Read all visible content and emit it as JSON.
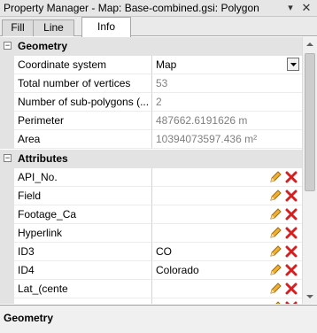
{
  "window": {
    "title": "Property Manager - Map: Base-combined.gsi: Polygon",
    "pin_icon": "pin-icon",
    "close_icon": "close-icon"
  },
  "tabs": [
    {
      "label": "Fill",
      "active": false
    },
    {
      "label": "Line",
      "active": false
    },
    {
      "label": "Info",
      "active": true
    }
  ],
  "geometry": {
    "category": "Geometry",
    "expander": "−",
    "rows": [
      {
        "name": "Coordinate system",
        "value": "Map",
        "readonly": false,
        "dropdown": true
      },
      {
        "name": "Total number of vertices",
        "value": "53",
        "readonly": true
      },
      {
        "name": "Number of sub-polygons (...",
        "value": "2",
        "readonly": true
      },
      {
        "name": "Perimeter",
        "value": "487662.6191626 m",
        "readonly": true
      },
      {
        "name": "Area",
        "value": "10394073597.436 m²",
        "readonly": true
      }
    ]
  },
  "attributes": {
    "category": "Attributes",
    "expander": "−",
    "rows": [
      {
        "name": "API_No.",
        "value": ""
      },
      {
        "name": "Field",
        "value": ""
      },
      {
        "name": "Footage_Ca",
        "value": ""
      },
      {
        "name": "Hyperlink",
        "value": ""
      },
      {
        "name": "ID3",
        "value": "CO"
      },
      {
        "name": "ID4",
        "value": "Colorado"
      },
      {
        "name": "Lat_(cente",
        "value": ""
      },
      {
        "name": "",
        "value": ""
      }
    ]
  },
  "description": {
    "title": "Geometry"
  },
  "colors": {
    "edit_pencil": "#e8a317",
    "delete_x": "#d42020",
    "category_bg": "#e3e3e3"
  }
}
